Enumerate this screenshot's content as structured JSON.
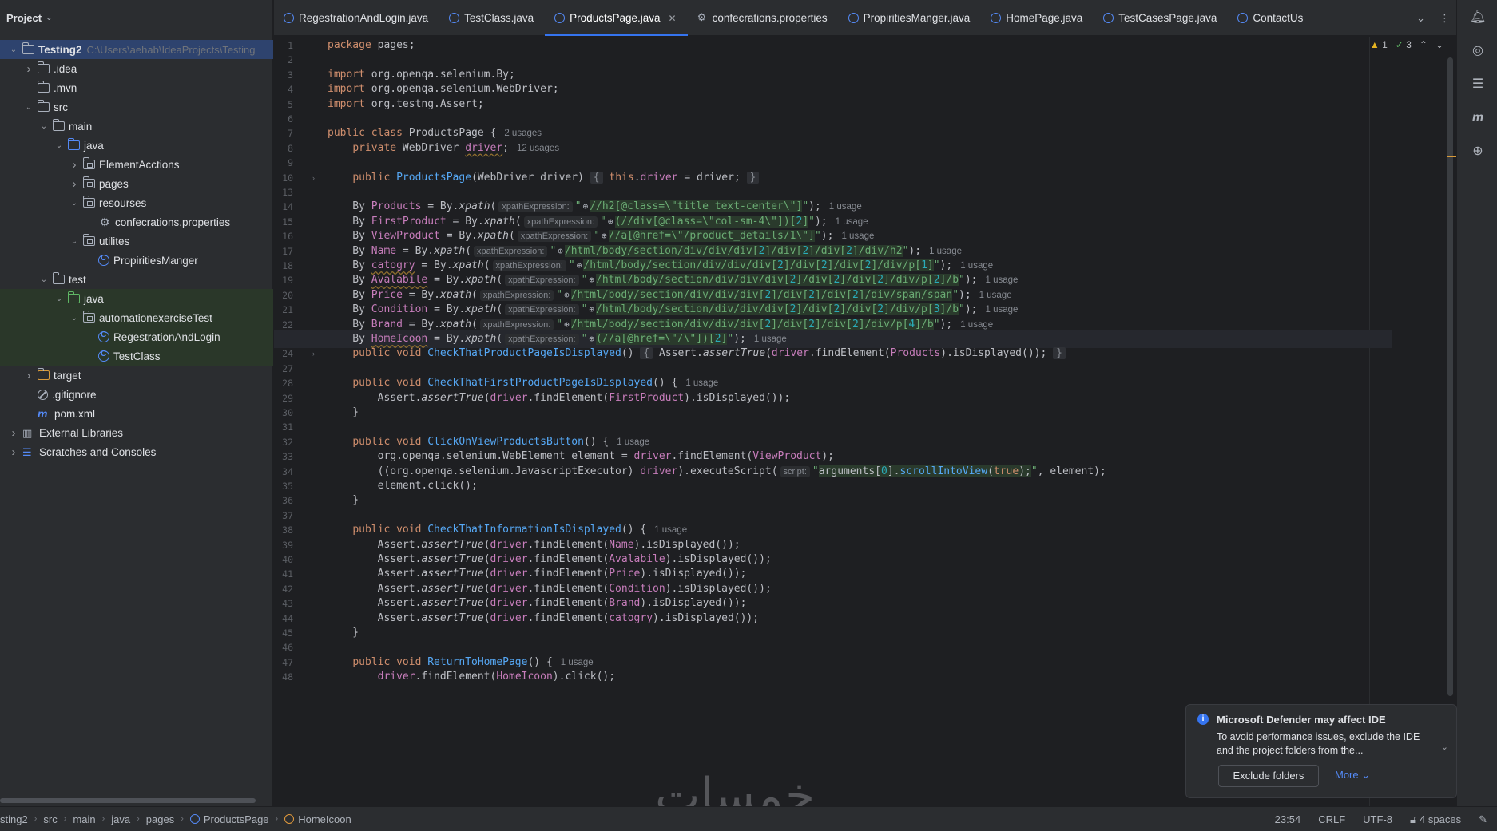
{
  "project_panel": {
    "title": "Project",
    "tree": [
      {
        "label": "Testing2",
        "path": "C:\\Users\\aehab\\IdeaProjects\\Testing",
        "depth": 0,
        "arrow": "down",
        "icon": "folder-module-icon",
        "selected": true
      },
      {
        "label": ".idea",
        "depth": 1,
        "arrow": "right",
        "icon": "folder-icon"
      },
      {
        "label": ".mvn",
        "depth": 1,
        "arrow": "",
        "icon": "folder-icon"
      },
      {
        "label": "src",
        "depth": 1,
        "arrow": "down",
        "icon": "folder-icon"
      },
      {
        "label": "main",
        "depth": 2,
        "arrow": "down",
        "icon": "folder-icon"
      },
      {
        "label": "java",
        "depth": 3,
        "arrow": "down",
        "icon": "source-folder-icon"
      },
      {
        "label": "ElementAcctions",
        "depth": 4,
        "arrow": "right",
        "icon": "package-icon"
      },
      {
        "label": "pages",
        "depth": 4,
        "arrow": "right",
        "icon": "package-icon"
      },
      {
        "label": "resourses",
        "depth": 4,
        "arrow": "down",
        "icon": "package-icon"
      },
      {
        "label": "confecrations.properties",
        "depth": 5,
        "arrow": "",
        "icon": "properties-file-icon"
      },
      {
        "label": "utilites",
        "depth": 4,
        "arrow": "down",
        "icon": "package-icon"
      },
      {
        "label": "PropiritiesManger",
        "depth": 5,
        "arrow": "",
        "icon": "java-class-icon"
      },
      {
        "label": "test",
        "depth": 2,
        "arrow": "down",
        "icon": "folder-icon"
      },
      {
        "label": "java",
        "depth": 3,
        "arrow": "down",
        "icon": "test-folder-icon",
        "green": true
      },
      {
        "label": "automationexerciseTest",
        "depth": 4,
        "arrow": "down",
        "icon": "package-icon",
        "green": true
      },
      {
        "label": "RegestrationAndLogin",
        "depth": 5,
        "arrow": "",
        "icon": "java-class-icon",
        "green": true
      },
      {
        "label": "TestClass",
        "depth": 5,
        "arrow": "",
        "icon": "java-class-icon",
        "green": true
      },
      {
        "label": "target",
        "depth": 1,
        "arrow": "right",
        "icon": "excluded-folder-icon",
        "orange": true
      },
      {
        "label": ".gitignore",
        "depth": 1,
        "arrow": "",
        "icon": "ignore-file-icon"
      },
      {
        "label": "pom.xml",
        "depth": 1,
        "arrow": "",
        "icon": "maven-icon"
      },
      {
        "label": "External Libraries",
        "depth": 0,
        "arrow": "right",
        "icon": "library-icon"
      },
      {
        "label": "Scratches and Consoles",
        "depth": 0,
        "arrow": "right",
        "icon": "scratches-icon"
      }
    ]
  },
  "tabs": [
    {
      "label": "RegestrationAndLogin.java",
      "icon": "java-class-icon",
      "active": false
    },
    {
      "label": "TestClass.java",
      "icon": "java-class-icon",
      "active": false
    },
    {
      "label": "ProductsPage.java",
      "icon": "java-class-icon",
      "active": true
    },
    {
      "label": "confecrations.properties",
      "icon": "properties-file-icon",
      "active": false
    },
    {
      "label": "PropiritiesManger.java",
      "icon": "java-class-icon",
      "active": false
    },
    {
      "label": "HomePage.java",
      "icon": "java-class-icon",
      "active": false
    },
    {
      "label": "TestCasesPage.java",
      "icon": "java-class-icon",
      "active": false
    },
    {
      "label": "ContactUs",
      "icon": "java-class-icon",
      "active": false
    }
  ],
  "inspection": {
    "warnings": "1",
    "ok": "3"
  },
  "editor": {
    "lines": [
      {
        "n": "1",
        "html": "<span class=\"kw\">package</span> pages;"
      },
      {
        "n": "2",
        "html": ""
      },
      {
        "n": "3",
        "html": "<span class=\"kw\">import</span> org.openqa.selenium.By;"
      },
      {
        "n": "4",
        "html": "<span class=\"kw\">import</span> org.openqa.selenium.WebDriver;"
      },
      {
        "n": "5",
        "html": "<span class=\"kw\">import</span> org.testng.Assert;"
      },
      {
        "n": "6",
        "html": ""
      },
      {
        "n": "7",
        "html": "<span class=\"kw\">public class</span> ProductsPage {<span class=\"hint\">2 usages</span>"
      },
      {
        "n": "8",
        "html": "    <span class=\"kw\">private</span> WebDriver <span class=\"fld underline\">driver</span>;<span class=\"hint\">12 usages</span>"
      },
      {
        "n": "9",
        "html": ""
      },
      {
        "n": "10",
        "html": "    <span class=\"kw\">public</span> <span class=\"fn\">ProductsPage</span>(WebDriver driver) <span class=\"fold-box\">{</span> <span class=\"kw\">this</span>.<span class=\"fld\">driver</span> = driver; <span class=\"fold-box\">}</span>",
        "fold": true
      },
      {
        "n": "13",
        "html": ""
      },
      {
        "n": "14",
        "html": "    By <span class=\"fld\">Products</span> = By.<span class=\"ital\">xpath</span>(<span class=\"inlay\">xpathExpression:</span><span class=\"str\">\"</span><span class=\"globe\">⊕</span><span class=\"str xp\">//h2[@class=\\\"title text-center\\\"]</span><span class=\"str\">\"</span>);<span class=\"hint\">1 usage</span>"
      },
      {
        "n": "15",
        "html": "    By <span class=\"fld\">FirstProduct</span> = By.<span class=\"ital\">xpath</span>(<span class=\"inlay\">xpathExpression:</span><span class=\"str\">\"</span><span class=\"globe\">⊕</span><span class=\"str xp\">(//div[@class=\\\"col-sm-4\\\"])[<span class=\"num\">2</span>]</span><span class=\"str\">\"</span>);<span class=\"hint\">1 usage</span>"
      },
      {
        "n": "16",
        "html": "    By <span class=\"fld\">ViewProduct</span> = By.<span class=\"ital\">xpath</span>(<span class=\"inlay\">xpathExpression:</span><span class=\"str\">\"</span><span class=\"globe\">⊕</span><span class=\"str xp\">//a[@href=\\\"/product_details/1\\\"]</span><span class=\"str\">\"</span>);<span class=\"hint\">1 usage</span>"
      },
      {
        "n": "17",
        "html": "    By <span class=\"fld\">Name</span> = By.<span class=\"ital\">xpath</span>(<span class=\"inlay\">xpathExpression:</span><span class=\"str\">\"</span><span class=\"globe\">⊕</span><span class=\"str xp\">/html/body/section/div/div/div[<span class=\"num\">2</span>]/div[<span class=\"num\">2</span>]/div[<span class=\"num\">2</span>]/div/h2</span><span class=\"str\">\"</span>);<span class=\"hint\">1 usage</span>"
      },
      {
        "n": "18",
        "html": "    By <span class=\"fld underline\">catogry</span> = By.<span class=\"ital\">xpath</span>(<span class=\"inlay\">xpathExpression:</span><span class=\"str\">\"</span><span class=\"globe\">⊕</span><span class=\"str xp\">/html/body/section/div/div/div[<span class=\"num\">2</span>]/div[<span class=\"num\">2</span>]/div[<span class=\"num\">2</span>]/div/p[<span class=\"num\">1</span>]</span><span class=\"str\">\"</span>);<span class=\"hint\">1 usage</span>"
      },
      {
        "n": "19",
        "html": "    By <span class=\"fld underline\">Avalabile</span> = By.<span class=\"ital\">xpath</span>(<span class=\"inlay\">xpathExpression:</span><span class=\"str\">\"</span><span class=\"globe\">⊕</span><span class=\"str xp\">/html/body/section/div/div/div[<span class=\"num\">2</span>]/div[<span class=\"num\">2</span>]/div[<span class=\"num\">2</span>]/div/p[<span class=\"num\">2</span>]/b</span><span class=\"str\">\"</span>);<span class=\"hint\">1 usage</span>"
      },
      {
        "n": "20",
        "html": "    By <span class=\"fld\">Price</span> = By.<span class=\"ital\">xpath</span>(<span class=\"inlay\">xpathExpression:</span><span class=\"str\">\"</span><span class=\"globe\">⊕</span><span class=\"str xp\">/html/body/section/div/div/div[<span class=\"num\">2</span>]/div[<span class=\"num\">2</span>]/div[<span class=\"num\">2</span>]/div/span/span</span><span class=\"str\">\"</span>);<span class=\"hint\">1 usage</span>"
      },
      {
        "n": "21",
        "html": "    By <span class=\"fld\">Condition</span> = By.<span class=\"ital\">xpath</span>(<span class=\"inlay\">xpathExpression:</span><span class=\"str\">\"</span><span class=\"globe\">⊕</span><span class=\"str xp\">/html/body/section/div/div/div[<span class=\"num\">2</span>]/div[<span class=\"num\">2</span>]/div[<span class=\"num\">2</span>]/div/p[<span class=\"num\">3</span>]/b</span><span class=\"str\">\"</span>);<span class=\"hint\">1 usage</span>"
      },
      {
        "n": "22",
        "html": "    By <span class=\"fld\">Brand</span> = By.<span class=\"ital\">xpath</span>(<span class=\"inlay\">xpathExpression:</span><span class=\"str\">\"</span><span class=\"globe\">⊕</span><span class=\"str xp\">/html/body/section/div/div/div[<span class=\"num\">2</span>]/div[<span class=\"num\">2</span>]/div[<span class=\"num\">2</span>]/div/p[<span class=\"num\">4</span>]/b</span><span class=\"str\">\"</span>);<span class=\"hint\">1 usage</span>"
      },
      {
        "n": "23",
        "html": "    By <span class=\"fld underline\">HomeIcoon</span> = By.<span class=\"ital\">xpath</span>(<span class=\"inlay\">xpathExpression:</span><span class=\"str\">\"</span><span class=\"globe\">⊕</span><span class=\"str xp\">(//a[@href=\\\"/\\\"])[<span class=\"num\">2</span>]</span><span class=\"str\">\"</span>);<span class=\"hint\">1 usage</span>",
        "current": true
      },
      {
        "n": "24",
        "html": "    <span class=\"kw\">public void</span> <span class=\"fn\">CheckThatProductPageIsDisplayed</span>() <span class=\"fold-box\">{</span> Assert.<span class=\"ital\">assertTrue</span>(<span class=\"fld\">driver</span>.findElement(<span class=\"fld\">Products</span>).isDisplayed()); <span class=\"fold-box\">}</span>",
        "fold": true
      },
      {
        "n": "27",
        "html": ""
      },
      {
        "n": "28",
        "html": "    <span class=\"kw\">public void</span> <span class=\"fn\">CheckThatFirstProductPageIsDisplayed</span>() {<span class=\"hint\">1 usage</span>"
      },
      {
        "n": "29",
        "html": "        Assert.<span class=\"ital\">assertTrue</span>(<span class=\"fld\">driver</span>.findElement(<span class=\"fld\">FirstProduct</span>).isDisplayed());"
      },
      {
        "n": "30",
        "html": "    }"
      },
      {
        "n": "31",
        "html": ""
      },
      {
        "n": "32",
        "html": "    <span class=\"kw\">public void</span> <span class=\"fn\">ClickOnViewProductsButton</span>() {<span class=\"hint\">1 usage</span>"
      },
      {
        "n": "33",
        "html": "        org.openqa.selenium.WebElement element = <span class=\"fld\">driver</span>.findElement(<span class=\"fld\">ViewProduct</span>);"
      },
      {
        "n": "34",
        "html": "        ((org.openqa.selenium.JavascriptExecutor) <span class=\"fld\">driver</span>).executeScript(<span class=\"inlay\">script:</span><span class=\"str\">\"</span><span class=\"xp\" style=\"color:#bcbec4\">arguments[<span class=\"num\">0</span>].<span class=\"fn\">scrollIntoView</span>(<span class=\"kw\">true</span>);</span><span class=\"str\">\"</span>, element);"
      },
      {
        "n": "35",
        "html": "        element.click();"
      },
      {
        "n": "36",
        "html": "    }"
      },
      {
        "n": "37",
        "html": ""
      },
      {
        "n": "38",
        "html": "    <span class=\"kw\">public void</span> <span class=\"fn\">CheckThatInformationIsDisplayed</span>() {<span class=\"hint\">1 usage</span>"
      },
      {
        "n": "39",
        "html": "        Assert.<span class=\"ital\">assertTrue</span>(<span class=\"fld\">driver</span>.findElement(<span class=\"fld\">Name</span>).isDisplayed());"
      },
      {
        "n": "40",
        "html": "        Assert.<span class=\"ital\">assertTrue</span>(<span class=\"fld\">driver</span>.findElement(<span class=\"fld\">Avalabile</span>).isDisplayed());"
      },
      {
        "n": "41",
        "html": "        Assert.<span class=\"ital\">assertTrue</span>(<span class=\"fld\">driver</span>.findElement(<span class=\"fld\">Price</span>).isDisplayed());"
      },
      {
        "n": "42",
        "html": "        Assert.<span class=\"ital\">assertTrue</span>(<span class=\"fld\">driver</span>.findElement(<span class=\"fld\">Condition</span>).isDisplayed());"
      },
      {
        "n": "43",
        "html": "        Assert.<span class=\"ital\">assertTrue</span>(<span class=\"fld\">driver</span>.findElement(<span class=\"fld\">Brand</span>).isDisplayed());"
      },
      {
        "n": "44",
        "html": "        Assert.<span class=\"ital\">assertTrue</span>(<span class=\"fld\">driver</span>.findElement(<span class=\"fld\">catogry</span>).isDisplayed());"
      },
      {
        "n": "45",
        "html": "    }"
      },
      {
        "n": "46",
        "html": ""
      },
      {
        "n": "47",
        "html": "    <span class=\"kw\">public void</span> <span class=\"fn\">ReturnToHomePage</span>() {<span class=\"hint\">1 usage</span>"
      },
      {
        "n": "48",
        "html": "        <span class=\"fld\">driver</span>.findElement(<span class=\"fld\">HomeIcoon</span>).click();"
      }
    ]
  },
  "notification": {
    "title": "Microsoft Defender may affect IDE",
    "body": "To avoid performance issues, exclude the IDE and the project folders from the...",
    "button": "Exclude folders",
    "more": "More"
  },
  "watermark": "خمسات",
  "status_bar": {
    "breadcrumbs": [
      "sting2",
      "src",
      "main",
      "java",
      "pages",
      "ProductsPage",
      "HomeIcoon"
    ],
    "position": "23:54",
    "line_ending": "CRLF",
    "encoding": "UTF-8",
    "indent": "4 spaces"
  }
}
